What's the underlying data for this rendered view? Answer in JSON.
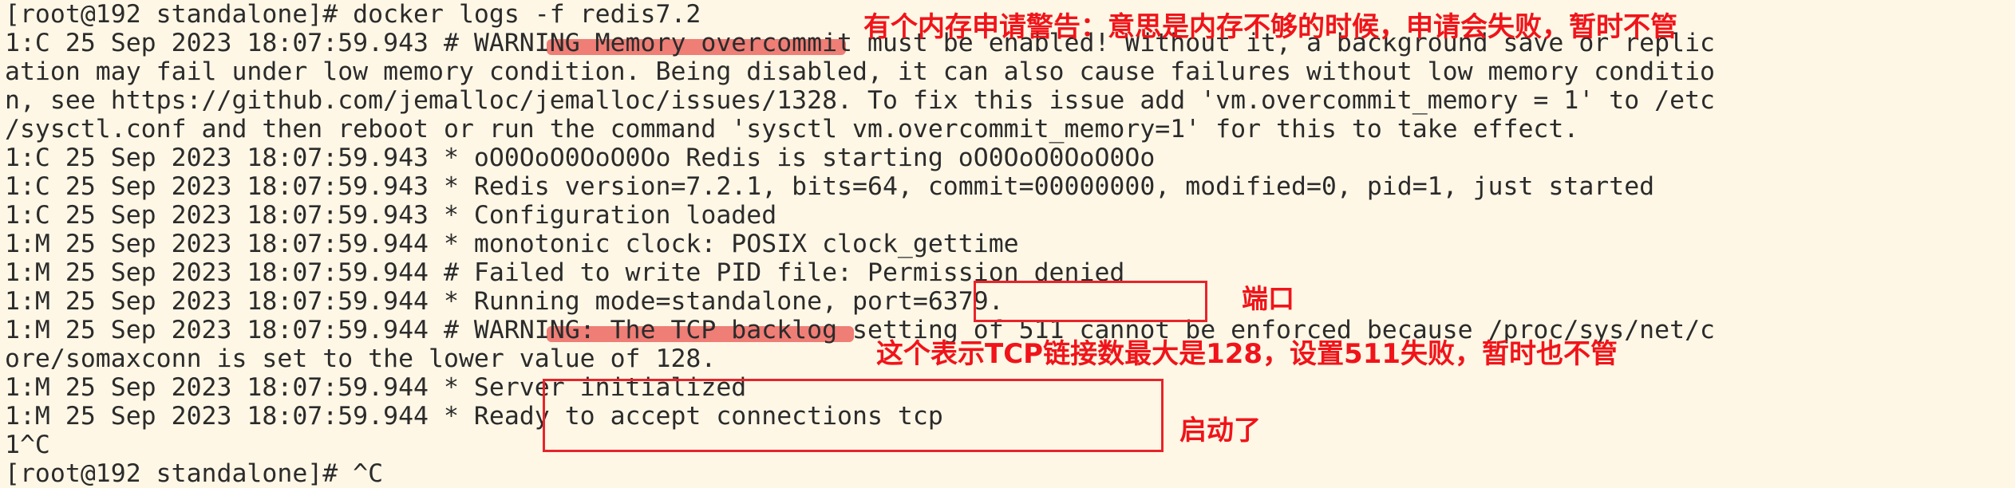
{
  "terminal": {
    "lines": [
      "[root@192 standalone]# docker logs -f redis7.2",
      "1:C 25 Sep 2023 18:07:59.943 # WARNING Memory overcommit must be enabled! Without it, a background save or replic",
      "ation may fail under low memory condition. Being disabled, it can also cause failures without low memory conditio",
      "n, see https://github.com/jemalloc/jemalloc/issues/1328. To fix this issue add 'vm.overcommit_memory = 1' to /etc",
      "/sysctl.conf and then reboot or run the command 'sysctl vm.overcommit_memory=1' for this to take effect.",
      "1:C 25 Sep 2023 18:07:59.943 * oO0OoO0OoO0Oo Redis is starting oO0OoO0OoO0Oo",
      "1:C 25 Sep 2023 18:07:59.943 * Redis version=7.2.1, bits=64, commit=00000000, modified=0, pid=1, just started",
      "1:C 25 Sep 2023 18:07:59.943 * Configuration loaded",
      "1:M 25 Sep 2023 18:07:59.944 * monotonic clock: POSIX clock_gettime",
      "1:M 25 Sep 2023 18:07:59.944 # Failed to write PID file: Permission denied",
      "1:M 25 Sep 2023 18:07:59.944 * Running mode=standalone, port=6379.",
      "1:M 25 Sep 2023 18:07:59.944 # WARNING: The TCP backlog setting of 511 cannot be enforced because /proc/sys/net/c",
      "ore/somaxconn is set to the lower value of 128.",
      "1:M 25 Sep 2023 18:07:59.944 * Server initialized",
      "1:M 25 Sep 2023 18:07:59.944 * Ready to accept connections tcp",
      "1^C",
      "[root@192 standalone]# ^C"
    ]
  },
  "annotations": {
    "memory_warning": "有个内存申请警告：意思是内存不够的时候，申请会失败，暂时不管",
    "port": "端口",
    "tcp_backlog": "这个表示TCP链接数最大是128，设置511失败，暂时也不管",
    "started": "启动了"
  },
  "colors": {
    "background": "#fff7e6",
    "text": "#2b2b2b",
    "annotation": "#f0141a",
    "highlight": "#ec6862"
  }
}
